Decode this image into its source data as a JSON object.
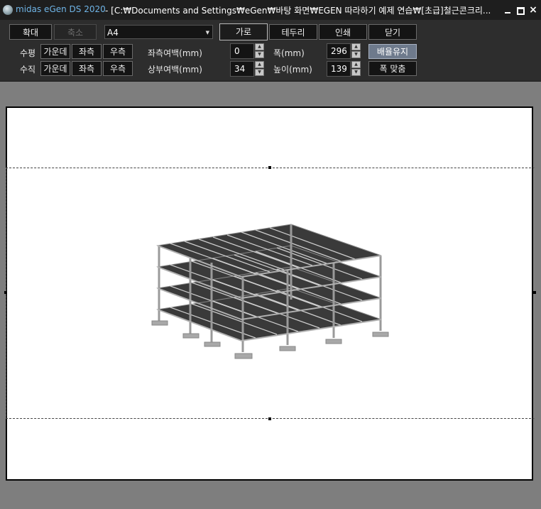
{
  "window": {
    "app_name": "midas eGen DS 2020",
    "path": "- [C:₩Documents and Settings₩eGen₩바탕 화면₩EGEN 따라하기 예제 연습₩[초급]철근콘크리...",
    "min_icon": "minimize-icon",
    "max_icon": "maximize-icon",
    "close_glyph": "×"
  },
  "toolbar": {
    "zoom_in": "확대",
    "zoom_out": "축소",
    "paper_size": "A4",
    "landscape": "가로",
    "border": "테두리",
    "print": "인쇄",
    "close": "닫기",
    "horizontal_label": "수평",
    "vertical_label": "수직",
    "h_center": "가운데",
    "h_left": "좌측",
    "h_right": "우측",
    "v_center": "가운데",
    "v_left": "좌측",
    "v_right": "우측",
    "left_margin_label": "좌측여백(mm)",
    "top_margin_label": "상부여백(mm)",
    "left_margin_value": "0",
    "top_margin_value": "34",
    "width_label": "폭(mm)",
    "height_label": "높이(mm)",
    "width_value": "296",
    "height_value": "139",
    "keep_ratio": "배율유지",
    "fit_width": "폭 맞춤"
  },
  "colors": {
    "title_accent": "#6fb4e6",
    "toolbar_bg": "#2d2d2d",
    "workarea_bg": "#7e7e7e",
    "highlight_btn": "#6e7a8c"
  }
}
